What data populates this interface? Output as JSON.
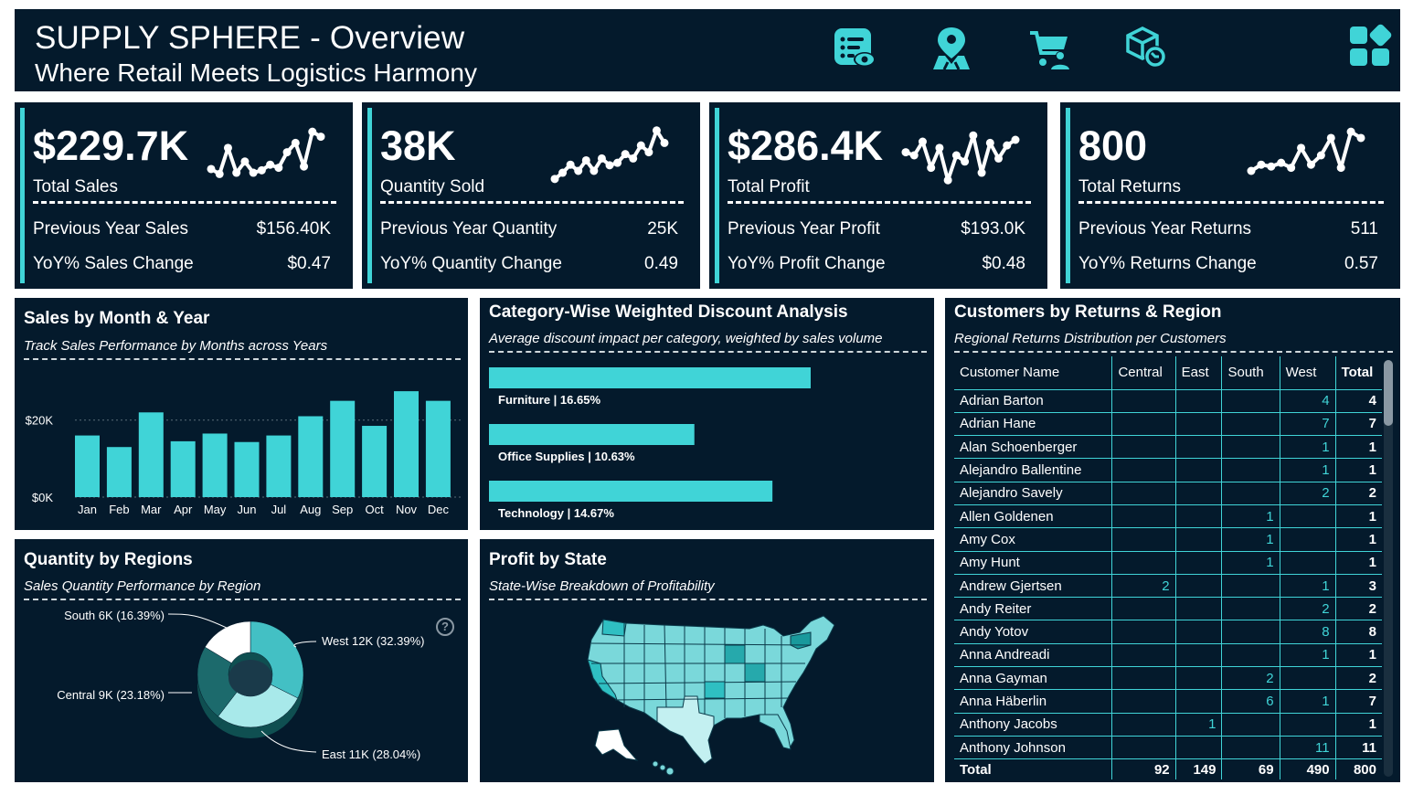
{
  "header": {
    "title": "SUPPLY SPHERE - Overview",
    "subtitle": "Where Retail Meets Logistics Harmony",
    "nav_icons": [
      "report-view-icon",
      "map-pin-icon",
      "cart-user-icon",
      "returns-box-icon",
      "dashboard-grid-icon"
    ]
  },
  "kpis": [
    {
      "value": "$229.7K",
      "label": "Total Sales",
      "row1_label": "Previous Year Sales",
      "row1_value": "$156.40K",
      "row2_label": "YoY% Sales Change",
      "row2_value": "$0.47"
    },
    {
      "value": "38K",
      "label": "Quantity Sold",
      "row1_label": "Previous Year Quantity",
      "row1_value": "25K",
      "row2_label": "YoY% Quantity Change",
      "row2_value": "0.49"
    },
    {
      "value": "$286.4K",
      "label": "Total Profit",
      "row1_label": "Previous Year Profit",
      "row1_value": "$193.0K",
      "row2_label": "YoY% Profit Change",
      "row2_value": "$0.48"
    },
    {
      "value": "800",
      "label": "Total Returns",
      "row1_label": "Previous Year Returns",
      "row1_value": "511",
      "row2_label": "YoY% Returns Change",
      "row2_value": "0.57"
    }
  ],
  "sparklines": [
    [
      0.28,
      0.2,
      0.62,
      0.22,
      0.4,
      0.22,
      0.26,
      0.35,
      0.3,
      0.55,
      0.7,
      0.32,
      0.88,
      0.8
    ],
    [
      0.12,
      0.22,
      0.35,
      0.25,
      0.42,
      0.25,
      0.45,
      0.34,
      0.38,
      0.52,
      0.45,
      0.66,
      0.55,
      0.9,
      0.7
    ],
    [
      0.55,
      0.5,
      0.72,
      0.3,
      0.62,
      0.1,
      0.5,
      0.4,
      0.82,
      0.22,
      0.7,
      0.45,
      0.66,
      0.75
    ],
    [
      0.25,
      0.35,
      0.32,
      0.38,
      0.3,
      0.62,
      0.35,
      0.5,
      0.78,
      0.3,
      0.88,
      0.78
    ]
  ],
  "colors": {
    "background": "#041a2c",
    "accent": "#40d4d7",
    "pie_west": "#43c0c4",
    "pie_east": "#a8e9ea",
    "pie_central": "#1c6a6c",
    "pie_south": "#ffffff"
  },
  "sales_panel": {
    "title": "Sales by Month & Year",
    "subtitle": "Track Sales Performance by Months across Years"
  },
  "discount_panel": {
    "title": "Category-Wise Weighted Discount Analysis",
    "subtitle": "Average discount impact per category, weighted by sales volume"
  },
  "quantity_panel": {
    "title": "Quantity by Regions",
    "subtitle": "Sales Quantity Performance by Region",
    "help_icon": "?"
  },
  "profit_panel": {
    "title": "Profit by State",
    "subtitle": "State-Wise Breakdown of Profitability"
  },
  "chart_data": [
    {
      "type": "bar",
      "categories": [
        "Jan",
        "Feb",
        "Mar",
        "Apr",
        "May",
        "Jun",
        "Jul",
        "Aug",
        "Sep",
        "Oct",
        "Nov",
        "Dec"
      ],
      "values": [
        16000,
        13000,
        22000,
        14500,
        16500,
        14300,
        16000,
        21000,
        25000,
        18500,
        27500,
        25000
      ],
      "y_ticks": [
        "$0K",
        "$20K"
      ],
      "ylim": [
        0,
        28000
      ]
    },
    {
      "type": "bar",
      "orientation": "horizontal",
      "categories": [
        "Furniture",
        "Office Supplies",
        "Technology"
      ],
      "values": [
        16.65,
        10.63,
        14.67
      ],
      "labels": [
        "Furniture | 16.65%",
        "Office Supplies | 10.63%",
        "Technology | 14.67%"
      ]
    },
    {
      "type": "pie",
      "categories": [
        "West",
        "East",
        "Central",
        "South"
      ],
      "values": [
        32.39,
        28.04,
        23.18,
        16.39
      ],
      "labels": [
        "West 12K (32.39%)",
        "East 11K (28.04%)",
        "Central 9K (23.18%)",
        "South 6K (16.39%)"
      ]
    }
  ],
  "customers": {
    "title": "Customers by Returns & Region",
    "subtitle": "Regional Returns Distribution per Customers",
    "columns": [
      "Customer Name",
      "Central",
      "East",
      "South",
      "West",
      "Total"
    ],
    "rows": [
      [
        "Adrian Barton",
        "",
        "",
        "",
        "4",
        "4"
      ],
      [
        "Adrian Hane",
        "",
        "",
        "",
        "7",
        "7"
      ],
      [
        "Alan Schoenberger",
        "",
        "",
        "",
        "1",
        "1"
      ],
      [
        "Alejandro Ballentine",
        "",
        "",
        "",
        "1",
        "1"
      ],
      [
        "Alejandro Savely",
        "",
        "",
        "",
        "2",
        "2"
      ],
      [
        "Allen Goldenen",
        "",
        "",
        "1",
        "",
        "1"
      ],
      [
        "Amy Cox",
        "",
        "",
        "1",
        "",
        "1"
      ],
      [
        "Amy Hunt",
        "",
        "",
        "1",
        "",
        "1"
      ],
      [
        "Andrew Gjertsen",
        "2",
        "",
        "",
        "1",
        "3"
      ],
      [
        "Andy Reiter",
        "",
        "",
        "",
        "2",
        "2"
      ],
      [
        "Andy Yotov",
        "",
        "",
        "",
        "8",
        "8"
      ],
      [
        "Anna Andreadi",
        "",
        "",
        "",
        "1",
        "1"
      ],
      [
        "Anna Gayman",
        "",
        "",
        "2",
        "",
        "2"
      ],
      [
        "Anna Häberlin",
        "",
        "",
        "6",
        "1",
        "7"
      ],
      [
        "Anthony Jacobs",
        "",
        "1",
        "",
        "",
        "1"
      ],
      [
        "Anthony Johnson",
        "",
        "",
        "",
        "11",
        "11"
      ]
    ],
    "total": [
      "Total",
      "92",
      "149",
      "69",
      "490",
      "800"
    ]
  }
}
